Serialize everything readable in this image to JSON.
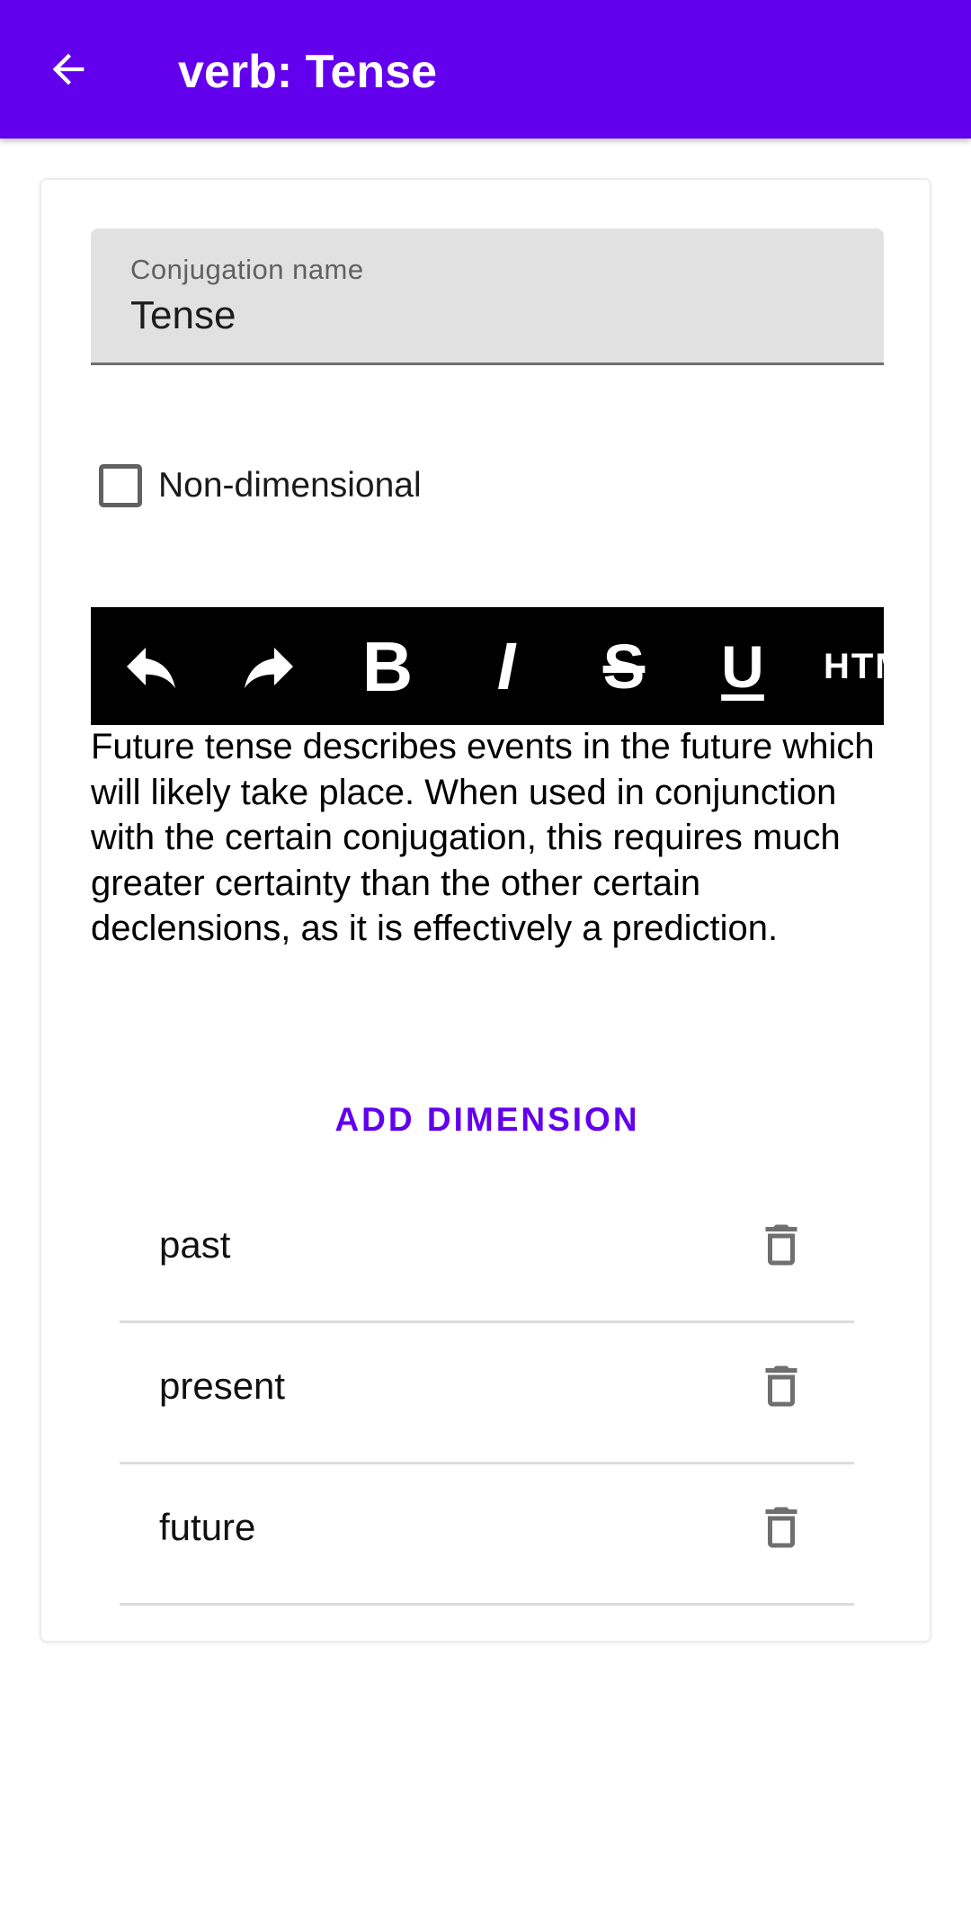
{
  "app_bar": {
    "title": "verb: Tense",
    "background": "#6200ee",
    "back_icon": "arrow-back-icon"
  },
  "form": {
    "name_field": {
      "label": "Conjugation name",
      "value": "Tense"
    },
    "non_dimensional": {
      "label": "Non-dimensional",
      "checked": false
    }
  },
  "toolbar": {
    "buttons": [
      {
        "icon": "undo-icon"
      },
      {
        "icon": "redo-icon"
      },
      {
        "icon": "bold-icon",
        "glyph": "B"
      },
      {
        "icon": "italic-icon",
        "glyph": "I"
      },
      {
        "icon": "strikethrough-icon",
        "glyph": "S"
      },
      {
        "icon": "underline-icon",
        "glyph": "U"
      },
      {
        "icon": "html-icon",
        "glyph": "HTML"
      }
    ]
  },
  "description": "Future tense describes events in the future which will likely take place. When used in conjunction with the certain conjugation, this requires much greater certainty than the other certain declensions, as it is effectively a prediction.",
  "add_dimension": {
    "label": "ADD DIMENSION",
    "color": "#6200ee"
  },
  "dimensions": [
    {
      "label": "past",
      "icon": "trash-icon"
    },
    {
      "label": "present",
      "icon": "trash-icon"
    },
    {
      "label": "future",
      "icon": "trash-icon"
    }
  ]
}
